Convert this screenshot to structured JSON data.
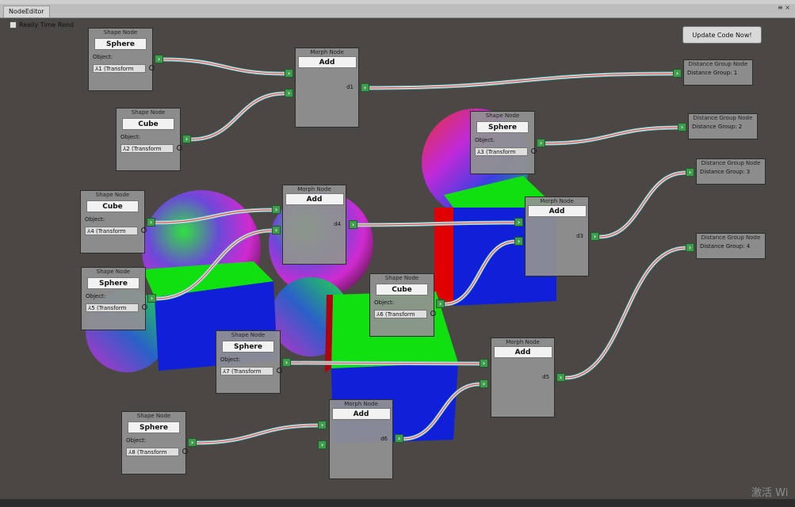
{
  "window": {
    "tab_label": "NodeEditor",
    "win_icons": "≡ ×"
  },
  "toolbar": {
    "realtime_label": "Really Time Rend",
    "update_label": "Update Code Now!"
  },
  "shape_nodes": [
    {
      "header": "Shape Node",
      "type": "Sphere",
      "object_label": "Object:",
      "object_value": "1 (Transform"
    },
    {
      "header": "Shape Node",
      "type": "Cube",
      "object_label": "Object:",
      "object_value": "2 (Transform"
    },
    {
      "header": "Shape Node",
      "type": "Sphere",
      "object_label": "Object:",
      "object_value": "3 (Transform"
    },
    {
      "header": "Shape Node",
      "type": "Cube",
      "object_label": "Object:",
      "object_value": "4 (Transform"
    },
    {
      "header": "Shape Node",
      "type": "Sphere",
      "object_label": "Object:",
      "object_value": "5 (Transform"
    },
    {
      "header": "Shape Node",
      "type": "Cube",
      "object_label": "Object:",
      "object_value": "6 (Transform"
    },
    {
      "header": "Shape Node",
      "type": "Sphere",
      "object_label": "Object:",
      "object_value": "7 (Transform"
    },
    {
      "header": "Shape Node",
      "type": "Sphere",
      "object_label": "Object:",
      "object_value": "8 (Transform"
    }
  ],
  "morph_nodes": [
    {
      "header": "Morph Node",
      "operation": "Add",
      "output": "d1"
    },
    {
      "header": "Morph Node",
      "operation": "Add",
      "output": "d4"
    },
    {
      "header": "Morph Node",
      "operation": "Add",
      "output": "d3"
    },
    {
      "header": "Morph Node",
      "operation": "Add",
      "output": "d5"
    },
    {
      "header": "Morph Node",
      "operation": "Add",
      "output": "d6"
    }
  ],
  "distance_nodes": [
    {
      "header": "Distance Group Node",
      "text": "Distance Group: 1"
    },
    {
      "header": "Distance Group Node",
      "text": "Distance Group: 2"
    },
    {
      "header": "Distance Group Node",
      "text": "Distance Group: 3"
    },
    {
      "header": "Distance Group Node",
      "text": "Distance Group: 4"
    }
  ],
  "watermark": "激活 Wi",
  "colors": {
    "canvas": "#4a4744",
    "node": "#919191",
    "port": "#3f9c4e",
    "wire_red": "#d94c4c",
    "wire_teal": "#6fc9c9",
    "cube_green": "#10e010",
    "cube_blue": "#1020d8",
    "cube_red": "#e00000"
  }
}
